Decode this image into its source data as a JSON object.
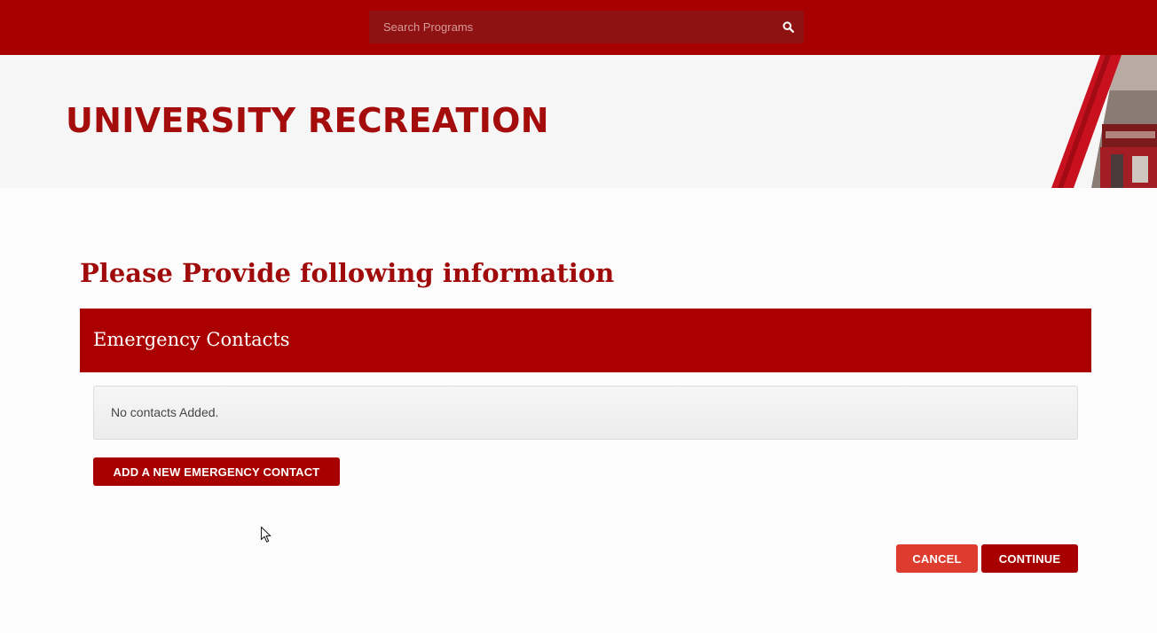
{
  "header": {
    "search": {
      "placeholder": "Search Programs",
      "value": ""
    },
    "search_icon": "search-icon"
  },
  "banner": {
    "title": "UNIVERSITY RECREATION"
  },
  "form": {
    "heading": "Please Provide following information",
    "section_title": "Emergency Contacts",
    "empty_message": "No contacts Added.",
    "add_button": "ADD A NEW EMERGENCY CONTACT"
  },
  "actions": {
    "cancel": "CANCEL",
    "continue": "CONTINUE"
  },
  "colors": {
    "brand_red": "#a80000",
    "cancel_red": "#dd3c2f",
    "banner_bg": "#f6f6f6"
  }
}
